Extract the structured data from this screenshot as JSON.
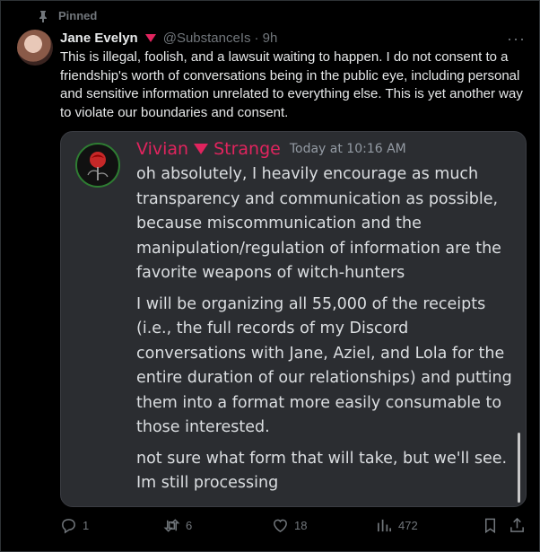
{
  "pinned": {
    "label": "Pinned",
    "icon": "pin-icon"
  },
  "tweet": {
    "author_name": "Jane Evelyn",
    "handle": "@SubstanceIs",
    "time": "· 9h",
    "more": "···",
    "text": "This is illegal, foolish, and a lawsuit waiting to happen. I do not consent to a friendship's worth of conversations being in the public eye, including personal and sensitive information unrelated to everything else. This is yet another way to violate our boundaries and consent."
  },
  "discord": {
    "name_first": "Vivian",
    "name_last": "Strange",
    "timestamp": "Today at 10:16 AM",
    "messages": [
      "oh absolutely, I heavily encourage as much transparency and communication as possible, because miscommunication and the manipulation/regulation of information are the favorite weapons of witch-hunters",
      "I will be organizing all 55,000 of the receipts (i.e., the full records of my Discord conversations with Jane, Aziel, and Lola for the entire duration of our relationships) and putting them into a format more easily consumable to those interested.",
      "not sure what form that will take, but we'll see. Im still processing"
    ]
  },
  "actions": {
    "replies": "1",
    "reposts": "6",
    "likes": "18",
    "views": "472"
  },
  "colors": {
    "accent_red": "#e0245e",
    "muted": "#71767b",
    "card_bg": "#2b2d31"
  }
}
